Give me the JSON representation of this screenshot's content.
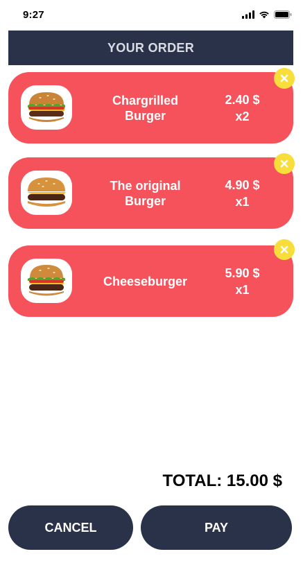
{
  "status_bar": {
    "time": "9:27",
    "icons": [
      "cellular-signal-icon",
      "wifi-icon",
      "battery-icon"
    ]
  },
  "header": {
    "title": "YOUR ORDER"
  },
  "colors": {
    "header_bg": "#2a3249",
    "card_bg": "#f5525b",
    "remove_bg": "#f8de3a",
    "button_bg": "#2a3249"
  },
  "order_items": [
    {
      "name_line1": "Chargrilled",
      "name_line2": "Burger",
      "price": "2.40 $",
      "qty": "x2",
      "image": "chargrilled-burger-image"
    },
    {
      "name_line1": "The original",
      "name_line2": "Burger",
      "price": "4.90 $",
      "qty": "x1",
      "image": "original-burger-image"
    },
    {
      "name_line1": "Cheeseburger",
      "name_line2": "",
      "price": "5.90 $",
      "qty": "x1",
      "image": "cheeseburger-image"
    }
  ],
  "total": {
    "label": "TOTAL: 15.00 $"
  },
  "buttons": {
    "cancel": "CANCEL",
    "pay": "PAY"
  }
}
